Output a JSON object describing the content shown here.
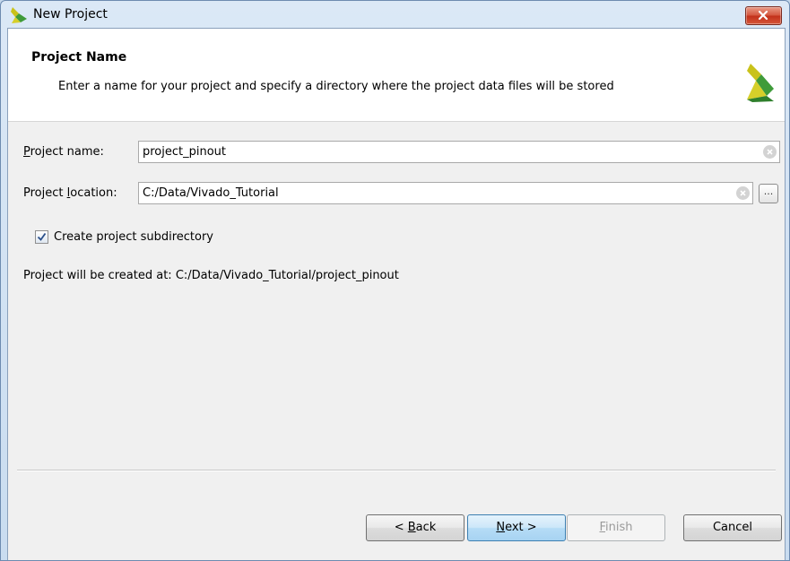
{
  "window": {
    "title": "New Project"
  },
  "header": {
    "title": "Project Name",
    "description": "Enter a name for your project and specify a directory where the project data files will be stored"
  },
  "form": {
    "project_name": {
      "label_mnemonic": "P",
      "label_rest": "roject name:",
      "value": "project_pinout"
    },
    "project_location": {
      "label_before": "Project ",
      "label_mnemonic": "l",
      "label_after": "ocation:",
      "value": "C:/Data/Vivado_Tutorial",
      "browse_label": "..."
    },
    "create_subdirectory": {
      "label": "Create project subdirectory",
      "checked": true
    },
    "info": "Project will be created at: C:/Data/Vivado_Tutorial/project_pinout"
  },
  "buttons": {
    "back": {
      "prefix": "< ",
      "mnemonic": "B",
      "rest": "ack"
    },
    "next": {
      "mnemonic": "N",
      "rest": "ext >"
    },
    "finish": {
      "mnemonic": "F",
      "rest": "inish",
      "enabled": false
    },
    "cancel": {
      "label": "Cancel"
    }
  },
  "colors": {
    "logo_yellow": "#c9c21a",
    "logo_green": "#3f9b3a",
    "close_red": "#c9361f"
  },
  "icons": {
    "title_logo": "vivado-logo-icon",
    "header_logo": "vivado-logo-icon",
    "close": "close-x-icon",
    "clear": "clear-x-icon",
    "checkbox": "checkmark-icon"
  }
}
